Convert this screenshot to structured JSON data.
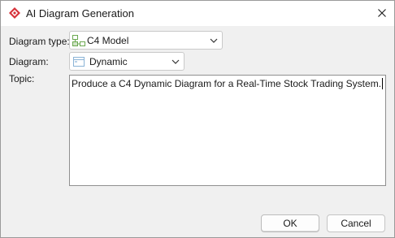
{
  "window": {
    "title": "AI Diagram Generation"
  },
  "form": {
    "diagram_type_label": "Diagram type:",
    "diagram_type_value": "C4 Model",
    "diagram_label": "Diagram:",
    "diagram_value": "Dynamic",
    "topic_label": "Topic:",
    "topic_value": "Produce a C4 Dynamic Diagram for a Real-Time Stock Trading System."
  },
  "buttons": {
    "ok": "OK",
    "cancel": "Cancel"
  },
  "icons": {
    "app": "app-logo-icon",
    "close": "close-icon",
    "diagram_type": "c4-model-icon",
    "diagram": "dynamic-diagram-icon",
    "dropdown": "chevron-down-icon"
  },
  "colors": {
    "app_icon": "#d6323a",
    "c4_icon": "#6aa84f"
  }
}
